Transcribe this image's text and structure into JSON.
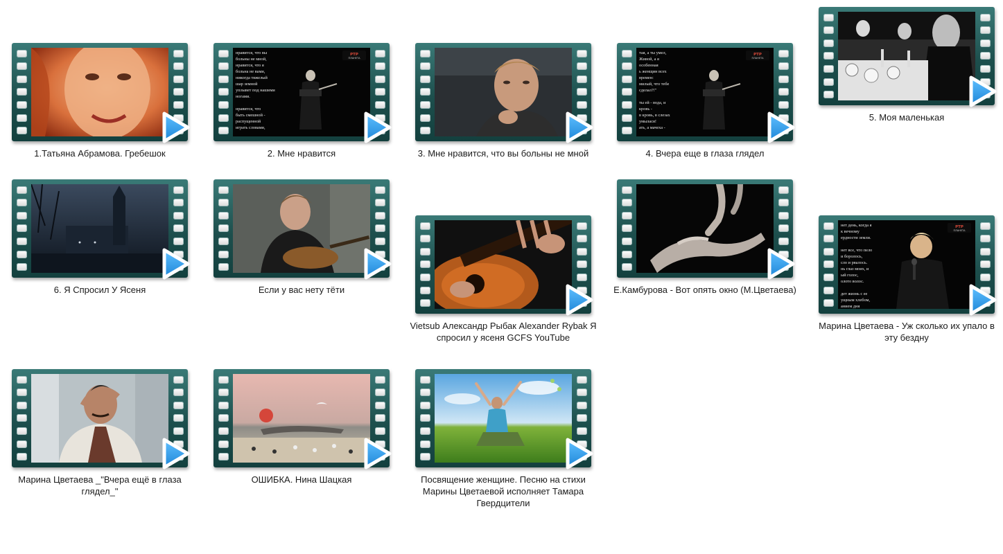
{
  "videos": [
    {
      "title": "1.Татьяна Абрамова. Гребешок",
      "scene": "face-warm"
    },
    {
      "title": "2. Мне нравится",
      "scene": "stage-text",
      "overlay_lines": [
        "нравится, что вы",
        "больны не мной,",
        "нравится, что я",
        "больна не вами,",
        "никогда тяжелый",
        "шар земной",
        "уплывет под нашими",
        "ногами.",
        "",
        "нравится, что",
        "быть смешной -",
        "распущенной",
        "играть словами,"
      ],
      "channel_logo": "РТР ПЛАНЕТА"
    },
    {
      "title": "3. Мне нравится, что вы больны не мной",
      "scene": "man-thinking"
    },
    {
      "title": "4. Вчера еще в глаза глядел",
      "scene": "stage-text",
      "overlay_lines": [
        "тая, а ты умел,",
        "Живой, а я",
        "особенная",
        "ь женщин всех",
        "времен:",
        "милый, что тебе",
        "сделал?!\"",
        "",
        "ты ей - вода, и",
        "кровь -",
        "в кровь, в слезах",
        "умылася!",
        "ать, а мачеха -"
      ],
      "channel_logo": "РТР ПЛАНЕТА"
    },
    {
      "title": "5. Моя маленькая",
      "scene": "bw-dinner"
    },
    {
      "title": "6.  Я Спросил У Ясеня",
      "scene": "night-city"
    },
    {
      "title": "Если у вас нету тёти",
      "scene": "man-guitar"
    },
    {
      "title": "Vietsub Александр Рыбак   Alexander Rybak   Я спросил у ясеня GCFS YouTube",
      "scene": "guitar-closeup"
    },
    {
      "title": "Е.Камбурова - Вот опять окно (М.Цветаева)",
      "scene": "hands"
    },
    {
      "title": "Марина Цветаева - Уж сколько их упало в эту бездну",
      "scene": "singer-text",
      "overlay_lines": [
        "нет день, когда я",
        "к вечному",
        "ердности земли.",
        "",
        "нет все, что пело",
        "и боролось,",
        "сло и рвалось.",
        "нь глаз моих, и",
        "ый голос,",
        "олото волос.",
        "",
        "дет жизнь с ее",
        "ущным хлебом,",
        "анием дня"
      ],
      "channel_logo": "РТР ПЛАНЕТА"
    },
    {
      "title": "Марина Цветаева _\"Вчера ещё в глаза глядел_\"",
      "scene": "man-scarf"
    },
    {
      "title": "ОШИБКА. Нина Шацкая",
      "scene": "sunset-beach"
    },
    {
      "title": "Посвящение женщине. Песню на стихи Марины Цветаевой исполняет Тамара Гвердцители",
      "scene": "woman-field"
    }
  ]
}
